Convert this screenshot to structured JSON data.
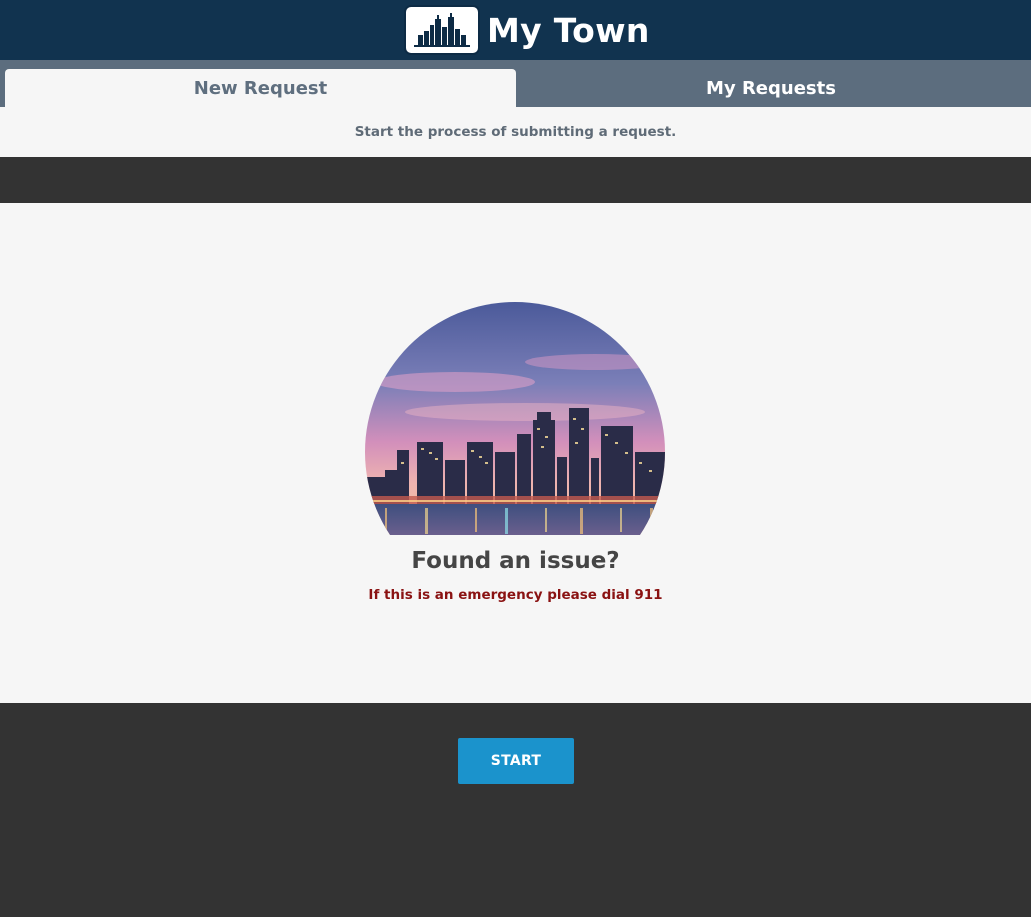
{
  "header": {
    "logo_icon": "city-skyline-icon",
    "title": "My Town"
  },
  "tabs": [
    {
      "label": "New Request",
      "active": true
    },
    {
      "label": "My Requests",
      "active": false
    }
  ],
  "subheader": {
    "text": "Start the process of submitting a request."
  },
  "main": {
    "hero_image": "city-skyline-photo",
    "title": "Found an issue?",
    "emergency_text": "If this is an emergency please dial 911"
  },
  "footer": {
    "start_label": "START"
  },
  "colors": {
    "header_bg": "#11334f",
    "tabbar_bg": "#5c6d7e",
    "panel_bg": "#f6f6f6",
    "dark_bg": "#333333",
    "accent": "#1b93cc",
    "emergency": "#8a1212"
  }
}
